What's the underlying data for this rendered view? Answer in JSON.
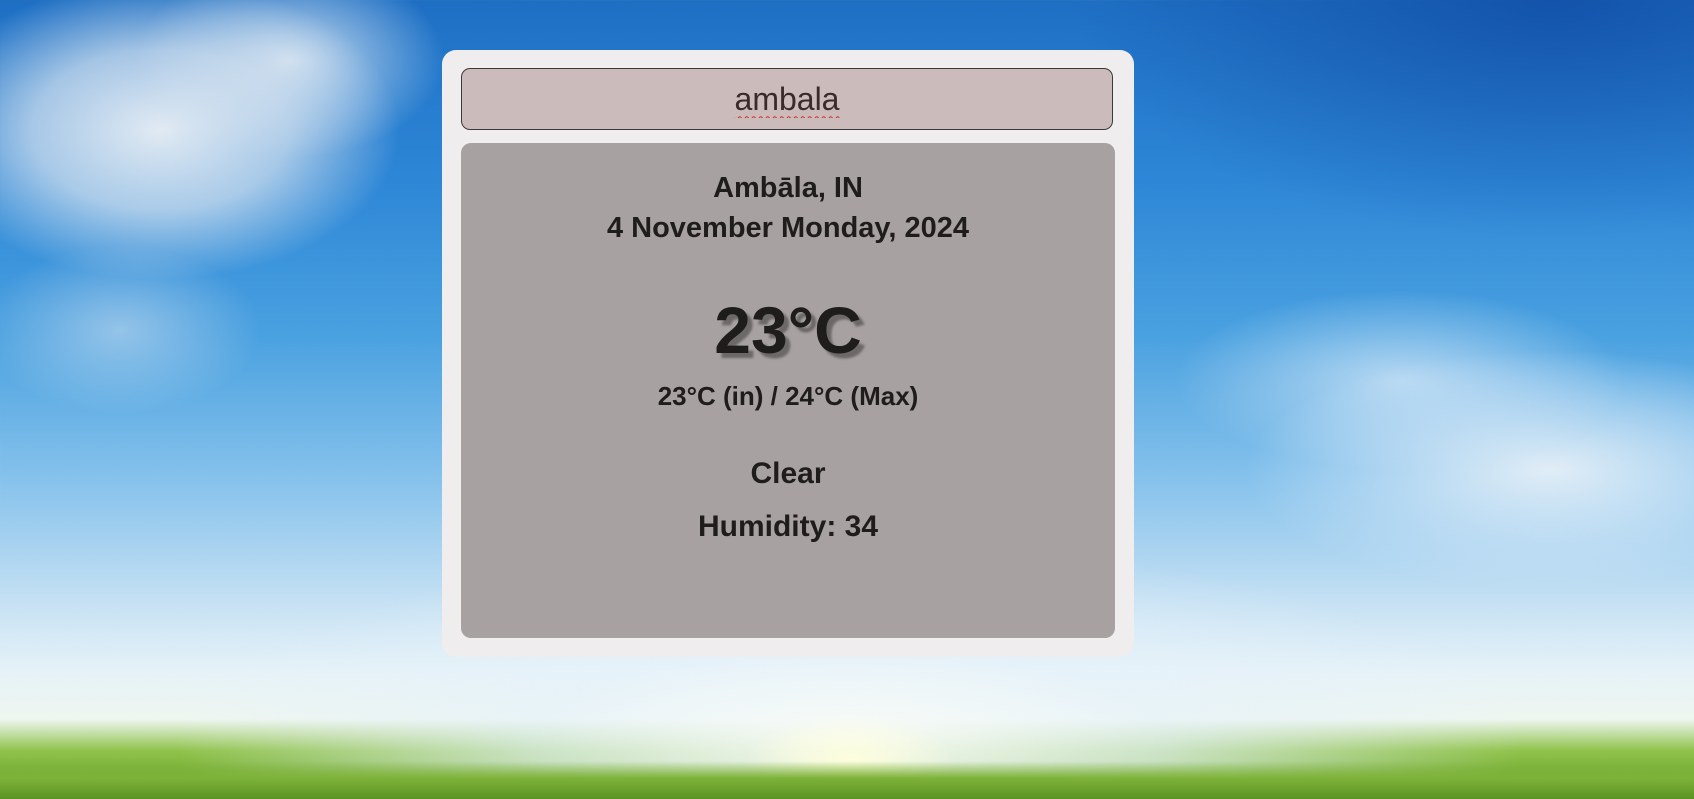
{
  "search": {
    "value": "ambala",
    "placeholder": ""
  },
  "weather": {
    "location": "Ambāla, IN",
    "date": "4 November Monday, 2024",
    "temperature": "23°C",
    "temp_range": "23°C (in) / 24°C (Max)",
    "condition": "Clear",
    "humidity": "Humidity: 34"
  },
  "colors": {
    "card_background": "#efeded",
    "input_background": "#cbbbbb",
    "panel_background": "#a8a1a1",
    "text": "#1f1c1c"
  }
}
